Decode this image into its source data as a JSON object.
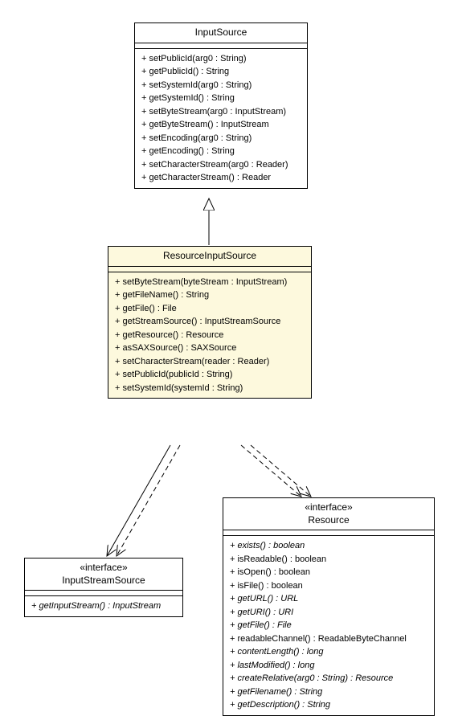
{
  "classes": {
    "inputSource": {
      "name": "InputSource",
      "ops": [
        "+ setPublicId(arg0 : String)",
        "+ getPublicId() : String",
        "+ setSystemId(arg0 : String)",
        "+ getSystemId() : String",
        "+ setByteStream(arg0 : InputStream)",
        "+ getByteStream() : InputStream",
        "+ setEncoding(arg0 : String)",
        "+ getEncoding() : String",
        "+ setCharacterStream(arg0 : Reader)",
        "+ getCharacterStream() : Reader"
      ]
    },
    "resourceInputSource": {
      "name": "ResourceInputSource",
      "ops": [
        "+ setByteStream(byteStream : InputStream)",
        "+ getFileName() : String",
        "+ getFile() : File",
        "+ getStreamSource() : InputStreamSource",
        "+ getResource() : Resource",
        "+ asSAXSource() : SAXSource",
        "+ setCharacterStream(reader : Reader)",
        "+ setPublicId(publicId : String)",
        "+ setSystemId(systemId : String)"
      ]
    },
    "inputStreamSource": {
      "stereotype": "«interface»",
      "name": "InputStreamSource",
      "ops": [
        {
          "text": "+ getInputStream() : InputStream",
          "abstract": true
        }
      ]
    },
    "resource": {
      "stereotype": "«interface»",
      "name": "Resource",
      "ops": [
        {
          "text": "+ exists() : boolean",
          "abstract": true
        },
        {
          "text": "+ isReadable() : boolean",
          "abstract": false
        },
        {
          "text": "+ isOpen() : boolean",
          "abstract": false
        },
        {
          "text": "+ isFile() : boolean",
          "abstract": false
        },
        {
          "text": "+ getURL() : URL",
          "abstract": true
        },
        {
          "text": "+ getURI() : URI",
          "abstract": true
        },
        {
          "text": "+ getFile() : File",
          "abstract": true
        },
        {
          "text": "+ readableChannel() : ReadableByteChannel",
          "abstract": false
        },
        {
          "text": "+ contentLength() : long",
          "abstract": true
        },
        {
          "text": "+ lastModified() : long",
          "abstract": true
        },
        {
          "text": "+ createRelative(arg0 : String) : Resource",
          "abstract": true
        },
        {
          "text": "+ getFilename() : String",
          "abstract": true
        },
        {
          "text": "+ getDescription() : String",
          "abstract": true
        }
      ]
    }
  }
}
